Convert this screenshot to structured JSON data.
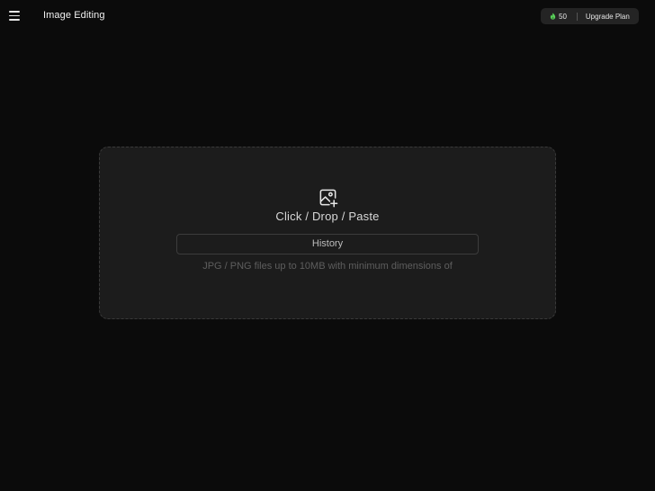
{
  "header": {
    "title": "Image Editing",
    "menu_icon": "hamburger-menu-icon",
    "credits_value": "50",
    "credits_icon": "flame-icon",
    "credits_color": "#5ad35a",
    "upgrade_label": "Upgrade Plan"
  },
  "upload": {
    "icon": "image-add-icon",
    "label": "Click / Drop / Paste",
    "history_label": "History",
    "hint": "JPG / PNG files up to 10MB with minimum dimensions of"
  }
}
